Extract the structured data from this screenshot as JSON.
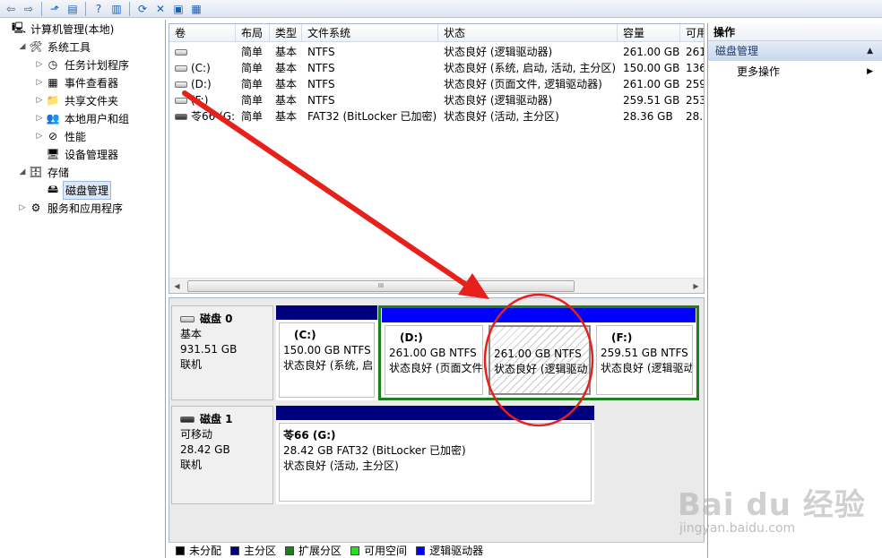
{
  "toolbar": {
    "icons": [
      "back-icon",
      "forward-icon",
      "up-folder-icon",
      "show-hide-tree-icon",
      "help-icon",
      "show-hide-action-icon",
      "refresh-icon",
      "delete-icon",
      "properties-icon",
      "help-topic-icon"
    ],
    "glyphs": [
      "⇦",
      "⇨",
      "⬏",
      "▤",
      "?",
      "▥",
      "⟳",
      "✕",
      "▣",
      "▦"
    ]
  },
  "tree": {
    "items": [
      {
        "label": "计算机管理(本地)",
        "level": 0,
        "exp": "",
        "icon": "computer-icon",
        "glyph": "🖳"
      },
      {
        "label": "系统工具",
        "level": 1,
        "exp": "◢",
        "icon": "tools-icon",
        "glyph": "🛠"
      },
      {
        "label": "任务计划程序",
        "level": 2,
        "exp": "▷",
        "icon": "task-scheduler-icon",
        "glyph": "◷"
      },
      {
        "label": "事件查看器",
        "level": 2,
        "exp": "▷",
        "icon": "event-viewer-icon",
        "glyph": "▦"
      },
      {
        "label": "共享文件夹",
        "level": 2,
        "exp": "▷",
        "icon": "shared-folder-icon",
        "glyph": "📁"
      },
      {
        "label": "本地用户和组",
        "level": 2,
        "exp": "▷",
        "icon": "users-icon",
        "glyph": "👥"
      },
      {
        "label": "性能",
        "level": 2,
        "exp": "▷",
        "icon": "performance-icon",
        "glyph": "⊘"
      },
      {
        "label": "设备管理器",
        "level": 2,
        "exp": "",
        "icon": "device-manager-icon",
        "glyph": "🖥"
      },
      {
        "label": "存储",
        "level": 1,
        "exp": "◢",
        "icon": "storage-icon",
        "glyph": "🗄"
      },
      {
        "label": "磁盘管理",
        "level": 2,
        "exp": "",
        "icon": "disk-management-icon",
        "glyph": "🖴",
        "selected": true
      },
      {
        "label": "服务和应用程序",
        "level": 1,
        "exp": "▷",
        "icon": "services-icon",
        "glyph": "⚙"
      }
    ]
  },
  "volume_list": {
    "columns": [
      "卷",
      "布局",
      "类型",
      "文件系统",
      "状态",
      "容量",
      "可用"
    ],
    "rows": [
      {
        "vol": "",
        "layout": "简单",
        "type": "基本",
        "fs": "NTFS",
        "status": "状态良好 (逻辑驱动器)",
        "cap": "261.00 GB",
        "free": "261"
      },
      {
        "vol": "(C:)",
        "layout": "简单",
        "type": "基本",
        "fs": "NTFS",
        "status": "状态良好 (系统, 启动, 活动, 主分区)",
        "cap": "150.00 GB",
        "free": "136"
      },
      {
        "vol": "(D:)",
        "layout": "简单",
        "type": "基本",
        "fs": "NTFS",
        "status": "状态良好 (页面文件, 逻辑驱动器)",
        "cap": "261.00 GB",
        "free": "259"
      },
      {
        "vol": "(F:)",
        "layout": "简单",
        "type": "基本",
        "fs": "NTFS",
        "status": "状态良好 (逻辑驱动器)",
        "cap": "259.51 GB",
        "free": "253"
      },
      {
        "vol": "苓66 (G:)",
        "layout": "简单",
        "type": "基本",
        "fs": "FAT32 (BitLocker 已加密)",
        "status": "状态良好 (活动, 主分区)",
        "cap": "28.36 GB",
        "free": "28."
      }
    ],
    "scroll_thumb": "III"
  },
  "disks": [
    {
      "name": "磁盘 0",
      "kind": "基本",
      "size": "931.51 GB",
      "state": "联机",
      "partitions": [
        {
          "name": "(C:)",
          "size": "150.00 GB NTFS",
          "status": "状态良好 (系统, 启",
          "bar": "#00007f"
        },
        {
          "name": "(D:)",
          "size": "261.00 GB NTFS",
          "status": "状态良好 (页面文件",
          "bar": "#0000ff"
        },
        {
          "name": "",
          "size": "261.00 GB NTFS",
          "status": "状态良好 (逻辑驱动",
          "bar": "#0000ff",
          "selected": true
        },
        {
          "name": "(F:)",
          "size": "259.51 GB NTFS",
          "status": "状态良好 (逻辑驱动",
          "bar": "#0000ff"
        }
      ]
    },
    {
      "name": "磁盘 1",
      "kind": "可移动",
      "size": "28.42 GB",
      "state": "联机",
      "partitions": [
        {
          "name": "苓66  (G:)",
          "size": "28.42 GB FAT32 (BitLocker 已加密)",
          "status": "状态良好 (活动, 主分区)",
          "bar": "#00007f"
        }
      ]
    }
  ],
  "legend": [
    {
      "label": "未分配",
      "color": "#000000"
    },
    {
      "label": "主分区",
      "color": "#00007f"
    },
    {
      "label": "扩展分区",
      "color": "#1d7f1d"
    },
    {
      "label": "可用空间",
      "color": "#22e022"
    },
    {
      "label": "逻辑驱动器",
      "color": "#0000ff"
    }
  ],
  "actions": {
    "title": "操作",
    "section": "磁盘管理",
    "more": "更多操作"
  },
  "colors": {
    "annotation": "#e8201b",
    "extended": "#1d7f1d"
  },
  "watermark": {
    "logo": "Bai du 经验",
    "url": "jingyan.baidu.com"
  }
}
